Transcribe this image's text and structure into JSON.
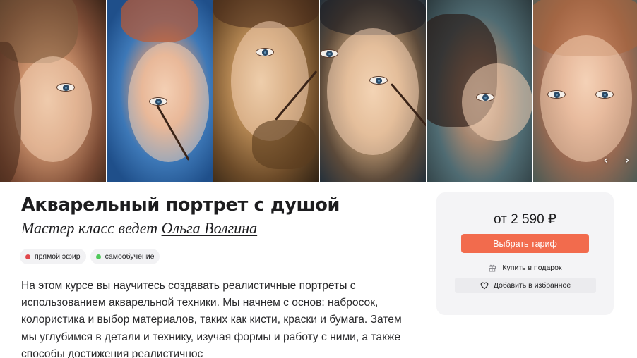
{
  "gallery": {
    "images": [
      {
        "name": "portrait-girl-hat-image"
      },
      {
        "name": "portrait-freckled-boy-image"
      },
      {
        "name": "portrait-bearded-man-image"
      },
      {
        "name": "portrait-woman-closeup-image"
      },
      {
        "name": "portrait-reclining-woman-image"
      },
      {
        "name": "portrait-red-haired-girl-image"
      }
    ],
    "prev_icon": "chevron-left-icon",
    "next_icon": "chevron-right-icon",
    "prev_glyph": "‹",
    "next_glyph": "›"
  },
  "course": {
    "title": "Акварельный портрет с душой",
    "subtitle_prefix": "Мастер класс ведет ",
    "author": "Ольга Волгина",
    "badges": [
      {
        "label": "прямой эфир",
        "color": "#e0474c"
      },
      {
        "label": "самообучение",
        "color": "#4fc85a"
      }
    ],
    "description": "На этом курсе вы научитесь создавать реалистичные портреты с использованием акварельной техники. Мы начнем с основ: набросок, колористика и выбор материалов, таких как кисти, краски и бумага. Затем мы углубимся в детали и технику, изучая формы и работу с ними, а также способы достижения реалистичнос"
  },
  "pricing": {
    "price": "от 2 590 ₽",
    "select_tariff_label": "Выбрать тариф",
    "gift_label": "Купить в подарок",
    "gift_icon": "gift-icon",
    "favorite_label": "Добавить в избранное",
    "favorite_icon": "heart-icon"
  },
  "colors": {
    "accent": "#f26b4d",
    "card_bg": "#f4f4f6"
  }
}
